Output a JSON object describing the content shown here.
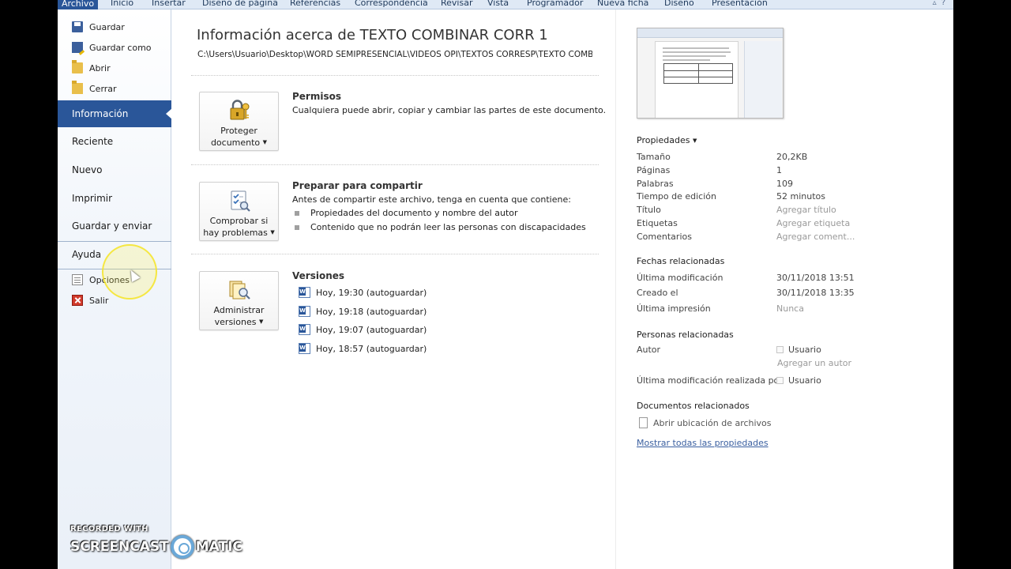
{
  "ribbon": {
    "tabs": [
      "Archivo",
      "Inicio",
      "Insertar",
      "Diseño de página",
      "Referencias",
      "Correspondencia",
      "Revisar",
      "Vista",
      "Programador",
      "Nueva ficha",
      "Diseño",
      "Presentación"
    ],
    "icons": [
      "minimize-ribbon-icon",
      "help-icon"
    ]
  },
  "menu": {
    "save": "Guardar",
    "save_as": "Guardar como",
    "open": "Abrir",
    "close": "Cerrar",
    "info": "Información",
    "recent": "Reciente",
    "new": "Nuevo",
    "print": "Imprimir",
    "save_send": "Guardar y enviar",
    "help": "Ayuda",
    "options": "Opciones",
    "exit": "Salir"
  },
  "info": {
    "title": "Información acerca de TEXTO COMBINAR CORR 1",
    "path": "C:\\Users\\Usuario\\Desktop\\WORD SEMIPRESENCIAL\\VIDEOS OPI\\TEXTOS CORRESP\\TEXTO COMBI...",
    "permissions": {
      "button_line1": "Proteger",
      "button_line2": "documento",
      "heading": "Permisos",
      "text": "Cualquiera puede abrir, copiar y cambiar las partes de este documento."
    },
    "prepare": {
      "button_line1": "Comprobar si",
      "button_line2": "hay problemas",
      "heading": "Preparar para compartir",
      "text": "Antes de compartir este archivo, tenga en cuenta que contiene:",
      "bullets": [
        "Propiedades del documento y nombre del autor",
        "Contenido que no podrán leer las personas con discapacidades"
      ]
    },
    "versions": {
      "button_line1": "Administrar",
      "button_line2": "versiones",
      "heading": "Versiones",
      "items": [
        "Hoy, 19:30 (autoguardar)",
        "Hoy, 19:18 (autoguardar)",
        "Hoy, 19:07 (autoguardar)",
        "Hoy, 18:57 (autoguardar)"
      ]
    }
  },
  "props": {
    "heading": "Propiedades",
    "rows": [
      {
        "label": "Tamaño",
        "value": "20,2KB"
      },
      {
        "label": "Páginas",
        "value": "1"
      },
      {
        "label": "Palabras",
        "value": "109"
      },
      {
        "label": "Tiempo de edición",
        "value": "52 minutos"
      },
      {
        "label": "Título",
        "value": "Agregar título"
      },
      {
        "label": "Etiquetas",
        "value": "Agregar etiqueta"
      },
      {
        "label": "Comentarios",
        "value": "Agregar coment..."
      }
    ],
    "dates_heading": "Fechas relacionadas",
    "dates": [
      {
        "label": "Última modificación",
        "value": "30/11/2018 13:51"
      },
      {
        "label": "Creado el",
        "value": "30/11/2018 13:35"
      },
      {
        "label": "Última impresión",
        "value": "Nunca"
      }
    ],
    "people_heading": "Personas relacionadas",
    "author_label": "Autor",
    "author_value": "Usuario",
    "add_author": "Agregar un autor",
    "last_modified_by_label": "Última modificación realizada por",
    "last_modified_by_value": "Usuario",
    "docs_heading": "Documentos relacionados",
    "open_location": "Abrir ubicación de archivos",
    "show_all": "Mostrar todas las propiedades"
  },
  "watermark": {
    "line1": "RECORDED WITH",
    "brand_a": "SCREENCAST",
    "brand_b": "MATIC"
  }
}
